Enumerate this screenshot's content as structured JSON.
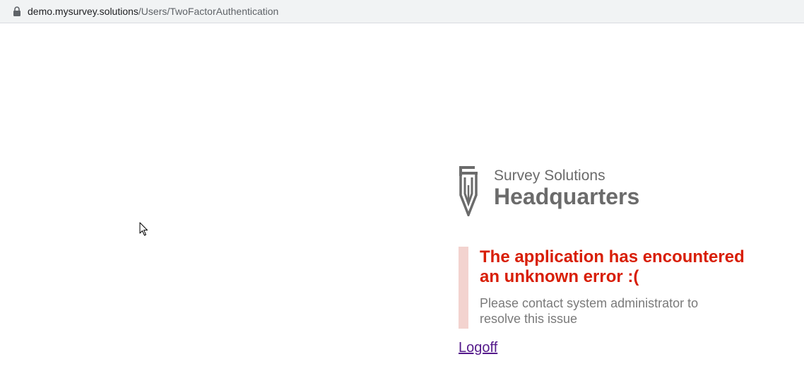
{
  "browser": {
    "url_host": "demo.mysurvey.solutions",
    "url_path": "/Users/TwoFactorAuthentication",
    "lock_icon": "lock-icon"
  },
  "logo": {
    "subtitle": "Survey Solutions",
    "title": "Headquarters",
    "icon": "pen-nib-icon"
  },
  "error": {
    "heading": "The application has encountered an unknown error :(",
    "message": "Please contact system administrator to resolve this issue",
    "title_color": "#d81e06",
    "accent_color": "#f3d3cf"
  },
  "actions": {
    "logoff_label": "Logoff"
  }
}
